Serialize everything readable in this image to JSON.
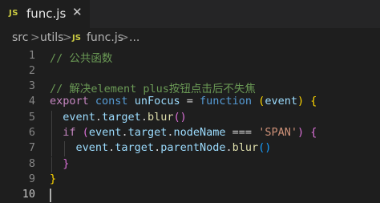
{
  "tab": {
    "icon": "JS",
    "label": "func.js",
    "close": "✕"
  },
  "breadcrumb": {
    "items": [
      "src",
      "utils",
      "func.js",
      "..."
    ],
    "icon": "JS",
    "separator": ">"
  },
  "editor": {
    "line_numbers": [
      "1",
      "2",
      "3",
      "4",
      "5",
      "6",
      "7",
      "8",
      "9",
      "10"
    ],
    "active_line": 10,
    "lines": [
      [
        {
          "t": "// 公共函数",
          "c": "comment"
        }
      ],
      [],
      [
        {
          "t": "// 解决element plus按钮点击后不失焦",
          "c": "comment"
        }
      ],
      [
        {
          "t": "export",
          "c": "flow"
        },
        {
          "t": " ",
          "c": "op"
        },
        {
          "t": "const",
          "c": "kw"
        },
        {
          "t": " ",
          "c": "op"
        },
        {
          "t": "unFocus",
          "c": "var"
        },
        {
          "t": " = ",
          "c": "op"
        },
        {
          "t": "function",
          "c": "kw"
        },
        {
          "t": " ",
          "c": "op"
        },
        {
          "t": "(",
          "c": "b1"
        },
        {
          "t": "event",
          "c": "var"
        },
        {
          "t": ")",
          "c": "b1"
        },
        {
          "t": " ",
          "c": "op"
        },
        {
          "t": "{",
          "c": "b1"
        }
      ],
      [
        {
          "t": "  ",
          "c": "op"
        },
        {
          "t": "event",
          "c": "var"
        },
        {
          "t": ".",
          "c": "op"
        },
        {
          "t": "target",
          "c": "var"
        },
        {
          "t": ".",
          "c": "op"
        },
        {
          "t": "blur",
          "c": "fn"
        },
        {
          "t": "()",
          "c": "b2"
        }
      ],
      [
        {
          "t": "  ",
          "c": "op"
        },
        {
          "t": "if",
          "c": "flow"
        },
        {
          "t": " ",
          "c": "op"
        },
        {
          "t": "(",
          "c": "b2"
        },
        {
          "t": "event",
          "c": "var"
        },
        {
          "t": ".",
          "c": "op"
        },
        {
          "t": "target",
          "c": "var"
        },
        {
          "t": ".",
          "c": "op"
        },
        {
          "t": "nodeName",
          "c": "var"
        },
        {
          "t": " === ",
          "c": "op"
        },
        {
          "t": "'SPAN'",
          "c": "str"
        },
        {
          "t": ")",
          "c": "b2"
        },
        {
          "t": " ",
          "c": "op"
        },
        {
          "t": "{",
          "c": "b2"
        }
      ],
      [
        {
          "t": "    ",
          "c": "op"
        },
        {
          "t": "event",
          "c": "var"
        },
        {
          "t": ".",
          "c": "op"
        },
        {
          "t": "target",
          "c": "var"
        },
        {
          "t": ".",
          "c": "op"
        },
        {
          "t": "parentNode",
          "c": "var"
        },
        {
          "t": ".",
          "c": "op"
        },
        {
          "t": "blur",
          "c": "fn"
        },
        {
          "t": "()",
          "c": "b3"
        }
      ],
      [
        {
          "t": "  ",
          "c": "op"
        },
        {
          "t": "}",
          "c": "b2"
        }
      ],
      [
        {
          "t": "}",
          "c": "b1"
        }
      ],
      []
    ]
  },
  "colors": {
    "background": "#1e1e1e",
    "tabbar": "#252526",
    "comment": "#6a9955",
    "keyword": "#569cd6",
    "control": "#c586c0",
    "variable": "#9cdcfe",
    "function": "#dcdcaa",
    "string": "#ce9178",
    "js_icon": "#cbcb41"
  }
}
